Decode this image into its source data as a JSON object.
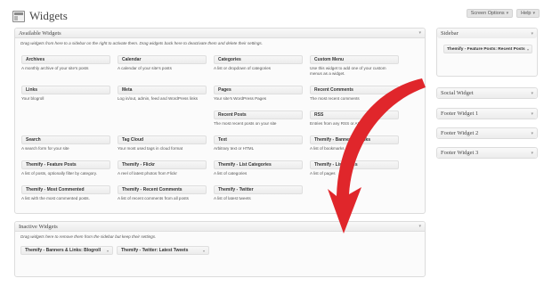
{
  "header": {
    "title": "Widgets",
    "icon": "widgets-icon"
  },
  "tabs": {
    "screen_options": "Screen Options",
    "help": "Help"
  },
  "available": {
    "title": "Available Widgets",
    "description": "Drag widgets from here to a sidebar on the right to activate them. Drag widgets back here to deactivate them and delete their settings.",
    "widgets": [
      {
        "title": "Archives",
        "desc": "A monthly archive of your site's posts"
      },
      {
        "title": "Calendar",
        "desc": "A calendar of your site's posts"
      },
      {
        "title": "Categories",
        "desc": "A list or dropdown of categories"
      },
      {
        "title": "Custom Menu",
        "desc": "Use this widget to add one of your custom menus as a widget."
      },
      {
        "title": "Links",
        "desc": "Your blogroll"
      },
      {
        "title": "Meta",
        "desc": "Log in/out, admin, feed and WordPress links"
      },
      {
        "title": "Pages",
        "desc": "Your site's WordPress Pages"
      },
      {
        "title": "Recent Comments",
        "desc": "The most recent comments"
      },
      {
        "title": "Recent Posts",
        "desc": "The most recent posts on your site"
      },
      {
        "title": "RSS",
        "desc": "Entries from any RSS or Atom feed"
      },
      {
        "title": "Search",
        "desc": "A search form for your site"
      },
      {
        "title": "Tag Cloud",
        "desc": "Your most used tags in cloud format"
      },
      {
        "title": "Text",
        "desc": "Arbitrary text or HTML"
      },
      {
        "title": "Themify - Banners & Links",
        "desc": "A list of bookmarks"
      },
      {
        "title": "Themify - Feature Posts",
        "desc": "A list of posts, optionally filter by category."
      },
      {
        "title": "Themify - Flickr",
        "desc": "A reel of latest photos from Flickr"
      },
      {
        "title": "Themify - List Categories",
        "desc": "A list of categories"
      },
      {
        "title": "Themify - List Pages",
        "desc": "A list of pages"
      },
      {
        "title": "Themify - Most Commented",
        "desc": "A list with the most commented posts."
      },
      {
        "title": "Themify - Recent Comments",
        "desc": "A list of recent comments from all posts"
      },
      {
        "title": "Themify - Twitter",
        "desc": "A list of latest tweets"
      }
    ]
  },
  "inactive": {
    "title": "Inactive Widgets",
    "description": "Drag widgets here to remove them from the sidebar but keep their settings.",
    "items": [
      "Themify - Banners & Links: Blogroll",
      "Themify - Twitter: Latest Tweets"
    ]
  },
  "sidebars": [
    {
      "title": "Sidebar",
      "widget": "Themify - Feature Posts: Recent Posts"
    },
    {
      "title": "Social Widget"
    },
    {
      "title": "Footer Widget 1"
    },
    {
      "title": "Footer Widget 2"
    },
    {
      "title": "Footer Widget 3"
    }
  ],
  "colors": {
    "arrow": "#e0262b",
    "panel_border": "#dcdcdc"
  }
}
